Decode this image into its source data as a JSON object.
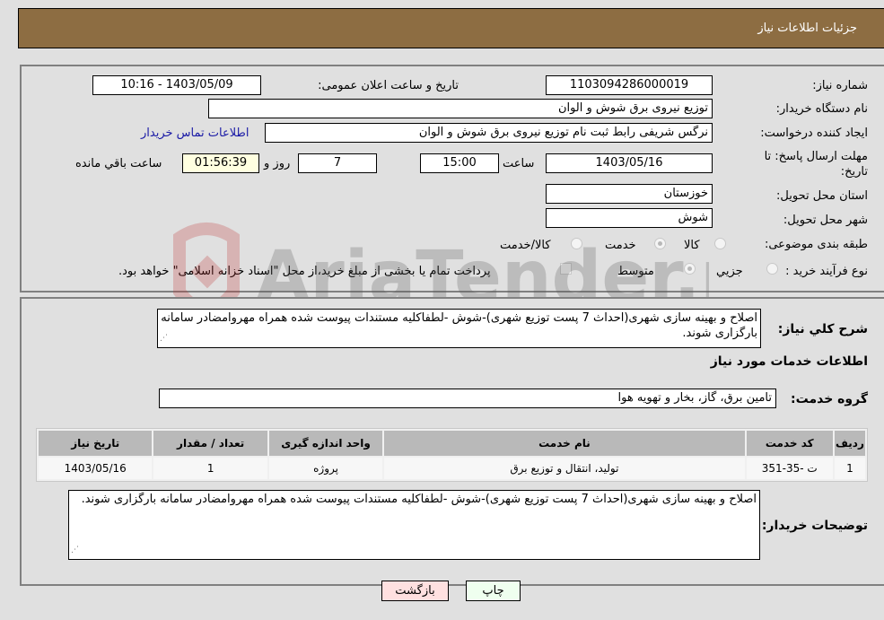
{
  "header": {
    "title": "جزئیات اطلاعات نیاز"
  },
  "fields": {
    "need_number_label": "شماره نیاز:",
    "need_number": "1103094286000019",
    "announce_label": "تاریخ و ساعت اعلان عمومی:",
    "announce_value": "1403/05/09 - 10:16",
    "buyer_org_label": "نام دستگاه خریدار:",
    "buyer_org": "توزیع نیروی برق شوش و الوان",
    "creator_label": "ایجاد کننده درخواست:",
    "creator": "نرگس شریفی رابط ثبت نام توزیع نیروی برق شوش و الوان",
    "contact_link": "اطلاعات تماس خریدار",
    "deadline_label": "مهلت ارسال پاسخ: تا تاریخ:",
    "deadline_date": "1403/05/16",
    "time_label": "ساعت",
    "deadline_time": "15:00",
    "days": "7",
    "days_label": "روز و",
    "remaining": "01:56:39",
    "remaining_label": "ساعت باقي مانده",
    "province_label": "استان محل تحویل:",
    "province": "خوزستان",
    "city_label": "شهر محل تحویل:",
    "city": "شوش",
    "category_label": "طبقه بندی موضوعی:",
    "category_options": [
      "کالا",
      "خدمت",
      "کالا/خدمت"
    ],
    "category_selected": "خدمت",
    "process_label": "نوع فرآیند خرید :",
    "process_options": [
      "جزيي",
      "متوسط"
    ],
    "process_selected": "متوسط",
    "treasury_note": "پرداخت تمام یا بخشی از مبلغ خرید،از محل \"اسناد خزانه اسلامی\" خواهد بود."
  },
  "section2": {
    "description_label": "شرح کلي نیاز:",
    "description": "اصلاح و بهینه سازی شهری(احداث 7 پست توزیع شهری)-شوش -لطفاکلیه مستندات پیوست شده همراه مهروامضادر سامانه بارگزاری شوند.",
    "services_title": "اطلاعات خدمات مورد نیاز",
    "service_group_label": "گروه خدمت:",
    "service_group": "تامین برق، گاز، بخار و تهویه هوا",
    "table": {
      "headers": [
        "ردیف",
        "کد خدمت",
        "نام خدمت",
        "واحد اندازه گیری",
        "تعداد / مقدار",
        "تاریخ نیاز"
      ],
      "rows": [
        [
          "1",
          "ت -35-351",
          "تولید، انتقال و توزیع برق",
          "پروژه",
          "1",
          "1403/05/16"
        ]
      ]
    },
    "buyer_notes_label": "توضیحات خریدار:",
    "buyer_notes": "اصلاح و بهینه سازی شهری(احداث 7 پست توزیع شهری)-شوش -لطفاکلیه مستندات پیوست شده همراه مهروامضادر سامانه بارگزاری شوند."
  },
  "buttons": {
    "print": "چاپ",
    "back": "بازگشت"
  },
  "colors": {
    "header_bg": "#8d6d42",
    "print_bg": "#efffef",
    "back_bg": "#ffe0e0",
    "link": "#1a1aa6"
  },
  "watermark": {
    "text": "AriaTender.neT"
  }
}
